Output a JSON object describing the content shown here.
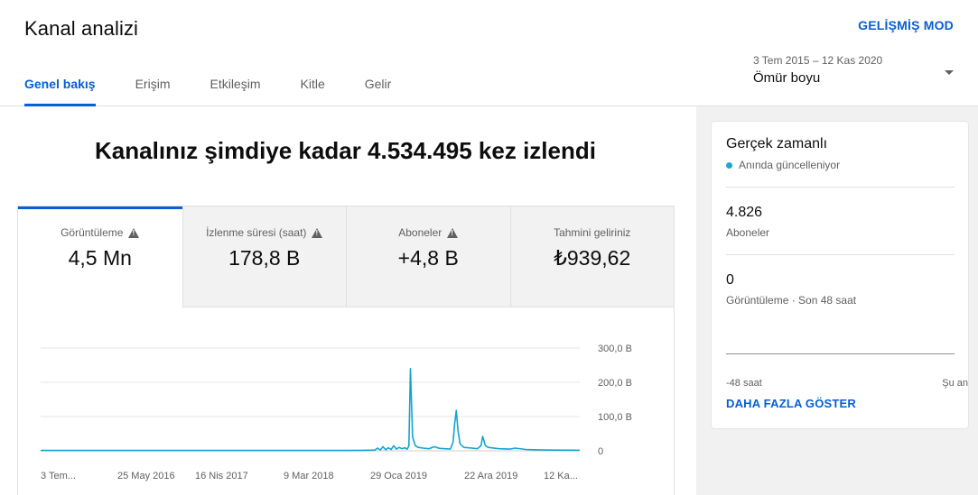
{
  "header": {
    "title": "Kanal analizi",
    "advanced_mode": "GELİŞMİŞ MOD",
    "tabs": [
      {
        "label": "Genel bakış"
      },
      {
        "label": "Erişim"
      },
      {
        "label": "Etkileşim"
      },
      {
        "label": "Kitle"
      },
      {
        "label": "Gelir"
      }
    ],
    "date_range": "3 Tem 2015 – 12 Kas 2020",
    "date_label": "Ömür boyu"
  },
  "main": {
    "headline": "Kanalınız şimdiye kadar 4.534.495 kez izlendi",
    "metrics": [
      {
        "label": "Görüntüleme",
        "value": "4,5 Mn"
      },
      {
        "label": "İzlenme süresi (saat)",
        "value": "178,8 B"
      },
      {
        "label": "Aboneler",
        "value": "+4,8 B"
      },
      {
        "label": "Tahmini geliriniz",
        "value": "₺939,62"
      }
    ]
  },
  "chart_data": {
    "type": "line",
    "x_tick_labels": [
      "3 Tem...",
      "25 May 2016",
      "16 Nis 2017",
      "9 Mar 2018",
      "29 Oca 2019",
      "22 Ara 2019",
      "12 Ka..."
    ],
    "y_tick_labels": [
      "300,0 B",
      "200,0 B",
      "100,0 B",
      "0"
    ],
    "ylim": [
      0,
      300000
    ],
    "grid": true,
    "color": "#12a4d0",
    "series": [
      {
        "points": [
          [
            0,
            1000
          ],
          [
            0.08,
            1000
          ],
          [
            0.16,
            1000
          ],
          [
            0.24,
            1000
          ],
          [
            0.32,
            1000
          ],
          [
            0.4,
            1000
          ],
          [
            0.48,
            1000
          ],
          [
            0.56,
            1000
          ],
          [
            0.6,
            1500
          ],
          [
            0.62,
            2000
          ],
          [
            0.625,
            8000
          ],
          [
            0.63,
            2500
          ],
          [
            0.635,
            12000
          ],
          [
            0.64,
            3000
          ],
          [
            0.645,
            9000
          ],
          [
            0.65,
            4000
          ],
          [
            0.655,
            15000
          ],
          [
            0.66,
            5000
          ],
          [
            0.665,
            10000
          ],
          [
            0.67,
            6000
          ],
          [
            0.675,
            9000
          ],
          [
            0.68,
            5000
          ],
          [
            0.683,
            15000
          ],
          [
            0.686,
            240000
          ],
          [
            0.69,
            40000
          ],
          [
            0.695,
            15000
          ],
          [
            0.7,
            10000
          ],
          [
            0.71,
            8000
          ],
          [
            0.72,
            6000
          ],
          [
            0.73,
            12000
          ],
          [
            0.74,
            7000
          ],
          [
            0.75,
            6000
          ],
          [
            0.76,
            5000
          ],
          [
            0.765,
            25000
          ],
          [
            0.768,
            80000
          ],
          [
            0.771,
            118000
          ],
          [
            0.774,
            60000
          ],
          [
            0.778,
            20000
          ],
          [
            0.785,
            10000
          ],
          [
            0.8,
            8000
          ],
          [
            0.81,
            6000
          ],
          [
            0.817,
            15000
          ],
          [
            0.82,
            42000
          ],
          [
            0.825,
            15000
          ],
          [
            0.83,
            10000
          ],
          [
            0.85,
            6000
          ],
          [
            0.87,
            5000
          ],
          [
            0.88,
            8000
          ],
          [
            0.9,
            4000
          ],
          [
            0.92,
            3000
          ],
          [
            0.95,
            2000
          ],
          [
            1.0,
            1500
          ]
        ]
      }
    ]
  },
  "realtime": {
    "title": "Gerçek zamanlı",
    "subtitle": "Anında güncelleniyor",
    "subscribers_value": "4.826",
    "subscribers_label": "Aboneler",
    "views_value": "0",
    "views_label": "Görüntüleme · Son 48 saat",
    "axis_left": "-48 saat",
    "axis_right": "Şu an",
    "show_more": "DAHA FAZLA GÖSTER"
  }
}
